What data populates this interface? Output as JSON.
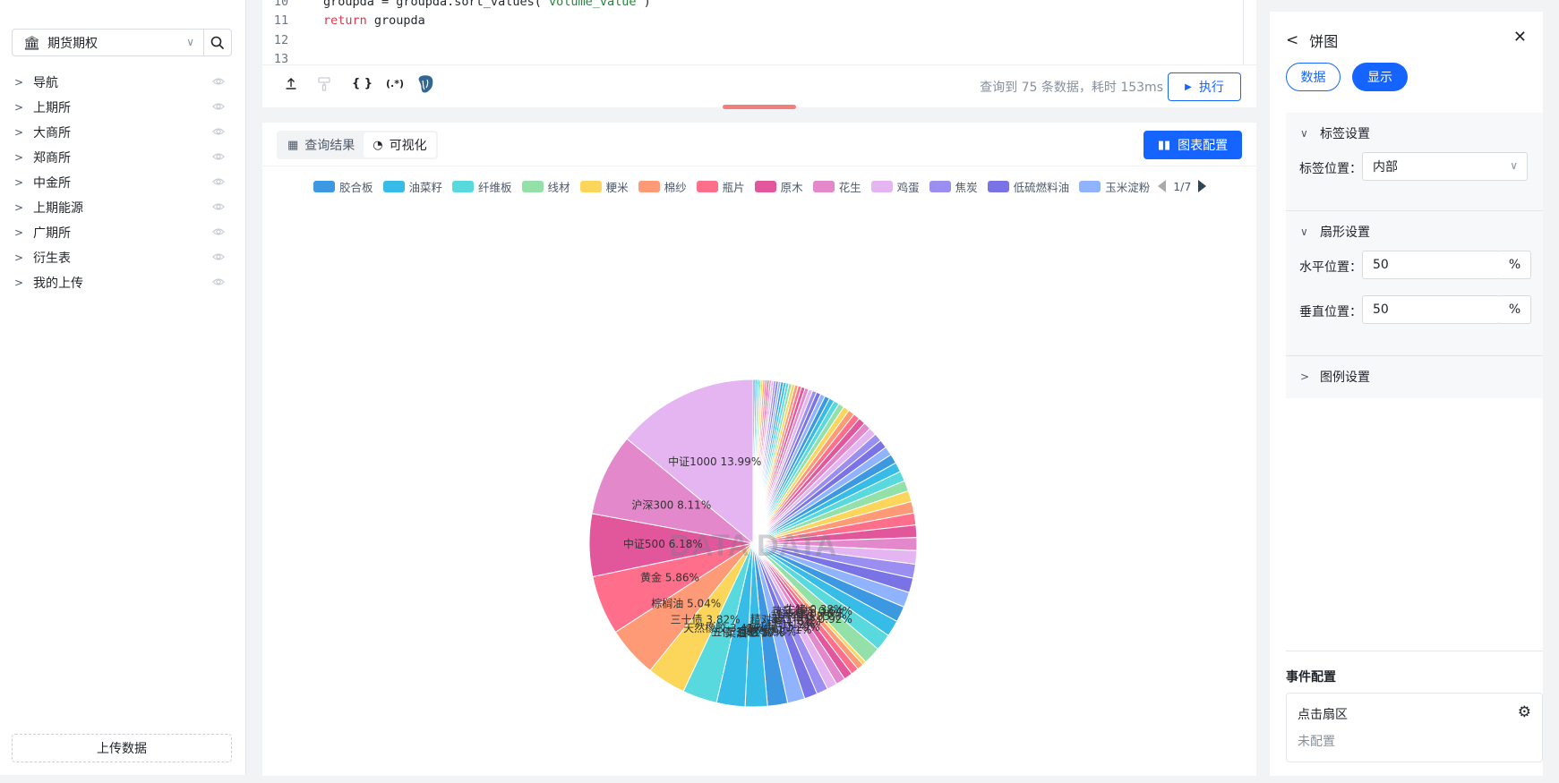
{
  "sidebar": {
    "selector": "期货期权",
    "tree": [
      "导航",
      "上期所",
      "大商所",
      "郑商所",
      "中金所",
      "上期能源",
      "广期所",
      "衍生表",
      "我的上传"
    ],
    "upload_label": "上传数据"
  },
  "editor": {
    "lines": [
      {
        "n": "10",
        "text": "groupda = groupda.sort_values('volume_value')"
      },
      {
        "n": "11",
        "text": "return groupda"
      },
      {
        "n": "12",
        "text": ""
      },
      {
        "n": "13",
        "text": ""
      }
    ],
    "query_info": "查询到 75 条数据，耗时 153ms",
    "run_label": "执行",
    "toolbar_icons": [
      "upload-icon",
      "format-brush-icon",
      "braces-icon",
      "regex-icon",
      "postgres-icon"
    ]
  },
  "result": {
    "tab_table": "查询结果",
    "tab_vis": "可视化",
    "config_label": "图表配置",
    "legend_page": "1/7"
  },
  "colors": {
    "accent": "#1664ff",
    "palette": [
      "#3c98e0",
      "#36bce6",
      "#57d9dd",
      "#93e0a9",
      "#fcd65a",
      "#fe9a76",
      "#ff6e8b",
      "#e2579c",
      "#e388cb",
      "#e4b5f1",
      "#9a8ef0",
      "#7a73e6",
      "#8fb3ff"
    ]
  },
  "chart_data": {
    "type": "pie",
    "label_position": "inside",
    "legend": [
      "胶合板",
      "油菜籽",
      "纤维板",
      "线材",
      "粳米",
      "棉纱",
      "瓶片",
      "原木",
      "花生",
      "鸡蛋",
      "焦炭",
      "低硫燃料油",
      "玉米淀粉"
    ],
    "labeled_slices": [
      {
        "name": "中证1000",
        "pct": 13.99
      },
      {
        "name": "沪深300",
        "pct": 8.11
      },
      {
        "name": "中证500",
        "pct": 6.18
      },
      {
        "name": "黄金",
        "pct": 5.86
      },
      {
        "name": "棕榈油",
        "pct": 5.04
      },
      {
        "name": "三十债",
        "pct": 3.82
      },
      {
        "name": "天然橡胶",
        "pct": 3.41
      },
      {
        "name": "五债",
        "pct": 2.81
      },
      {
        "name": "菜油",
        "pct": 2.19
      },
      {
        "name": "豆粕",
        "pct": 1.98
      },
      {
        "name": "螺纹钢",
        "pct": 1.71
      },
      {
        "name": "铁矿石",
        "pct": 1.29
      },
      {
        "name": "铝",
        "pct": 1.12
      },
      {
        "name": "锌",
        "pct": 1.01
      },
      {
        "name": "精对苯二甲酸",
        "pct": 0.92
      },
      {
        "name": "菜籽粕",
        "pct": 0.85
      },
      {
        "name": "工业硅",
        "pct": 0.76
      },
      {
        "name": "热轧卷板",
        "pct": 0.64
      },
      {
        "name": "生猪",
        "pct": 0.38
      }
    ],
    "other_slices_count": 56,
    "watermark": "DATA DATA"
  },
  "panel": {
    "title": "饼图",
    "tab_data": "数据",
    "tab_display": "显示",
    "label_section": "标签设置",
    "label_pos_label": "标签位置：",
    "label_pos_value": "内部",
    "sector_section": "扇形设置",
    "h_label": "水平位置：",
    "h_value": "50",
    "v_label": "垂直位置：",
    "v_value": "50",
    "unit": "%",
    "legend_section": "图例设置",
    "event_title": "事件配置",
    "event_name": "点击扇区",
    "event_status": "未配置"
  }
}
